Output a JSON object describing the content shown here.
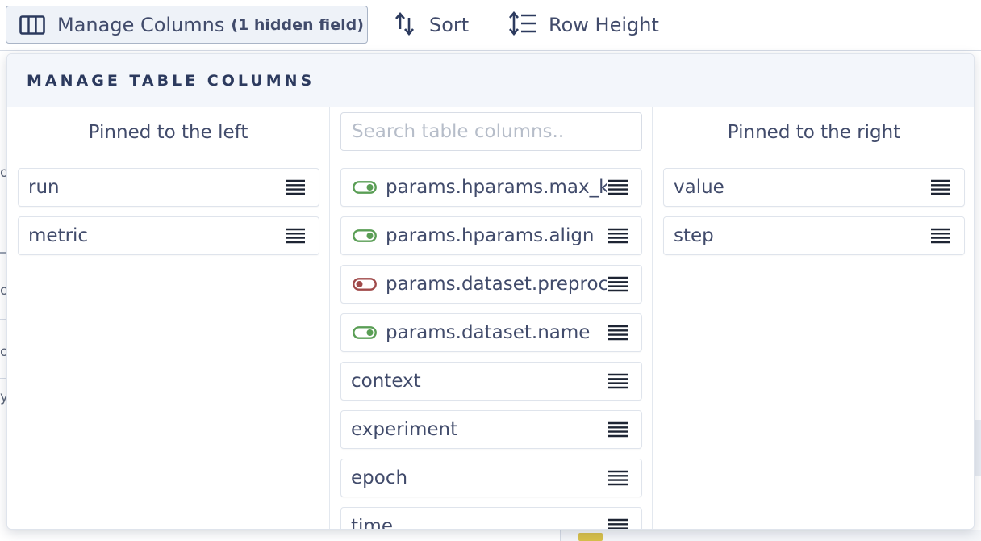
{
  "toolbar": {
    "manage_columns_label": "Manage Columns",
    "hidden_fields_label": "(1 hidden field)",
    "sort_label": "Sort",
    "row_height_label": "Row Height"
  },
  "popover": {
    "title": "MANAGE TABLE COLUMNS",
    "left_heading": "Pinned to the left",
    "right_heading": "Pinned to the right",
    "search_placeholder": "Search table columns..",
    "left_items": [
      {
        "label": "run"
      },
      {
        "label": "metric"
      }
    ],
    "middle_items": [
      {
        "label": "params.hparams.max_k",
        "toggle": "on"
      },
      {
        "label": "params.hparams.align",
        "toggle": "on"
      },
      {
        "label": "params.dataset.preproc",
        "toggle": "off"
      },
      {
        "label": "params.dataset.name",
        "toggle": "on"
      },
      {
        "label": "context"
      },
      {
        "label": "experiment"
      },
      {
        "label": "epoch"
      },
      {
        "label": "time"
      }
    ],
    "right_items": [
      {
        "label": "value"
      },
      {
        "label": "step"
      }
    ]
  },
  "colors": {
    "toggle_on": "#5a9e55",
    "toggle_off": "#a04a4a",
    "text": "#414b6b",
    "title": "#2c3a5e"
  },
  "icons": {
    "manage_columns": "columns-icon",
    "sort": "sort-arrows-icon",
    "row_height": "row-height-icon",
    "drag": "drag-handle-icon",
    "toggle": "visibility-toggle-icon"
  }
}
